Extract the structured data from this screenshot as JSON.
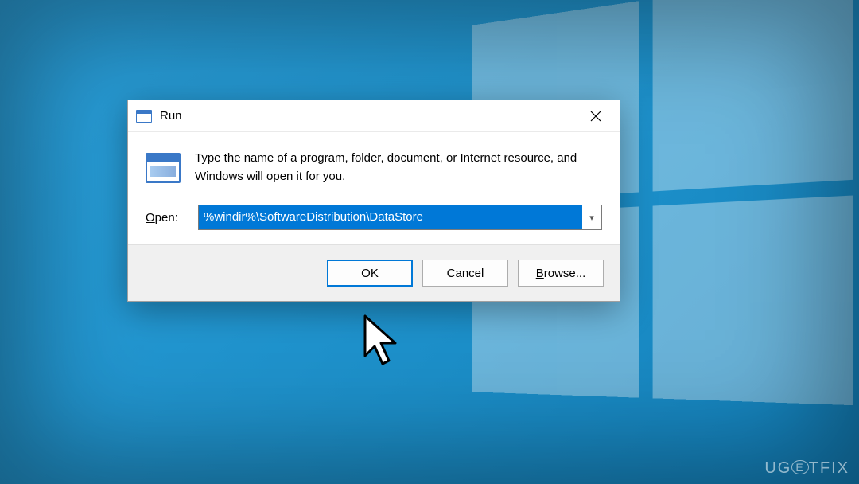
{
  "dialog": {
    "title": "Run",
    "description": "Type the name of a program, folder, document, or Internet resource, and Windows will open it for you.",
    "open_label_pre": "O",
    "open_label_post": "pen:",
    "input_value": "%windir%\\SoftwareDistribution\\DataStore",
    "buttons": {
      "ok": "OK",
      "cancel": "Cancel",
      "browse_pre": "B",
      "browse_post": "rowse..."
    }
  },
  "watermark": "UGETFIX"
}
